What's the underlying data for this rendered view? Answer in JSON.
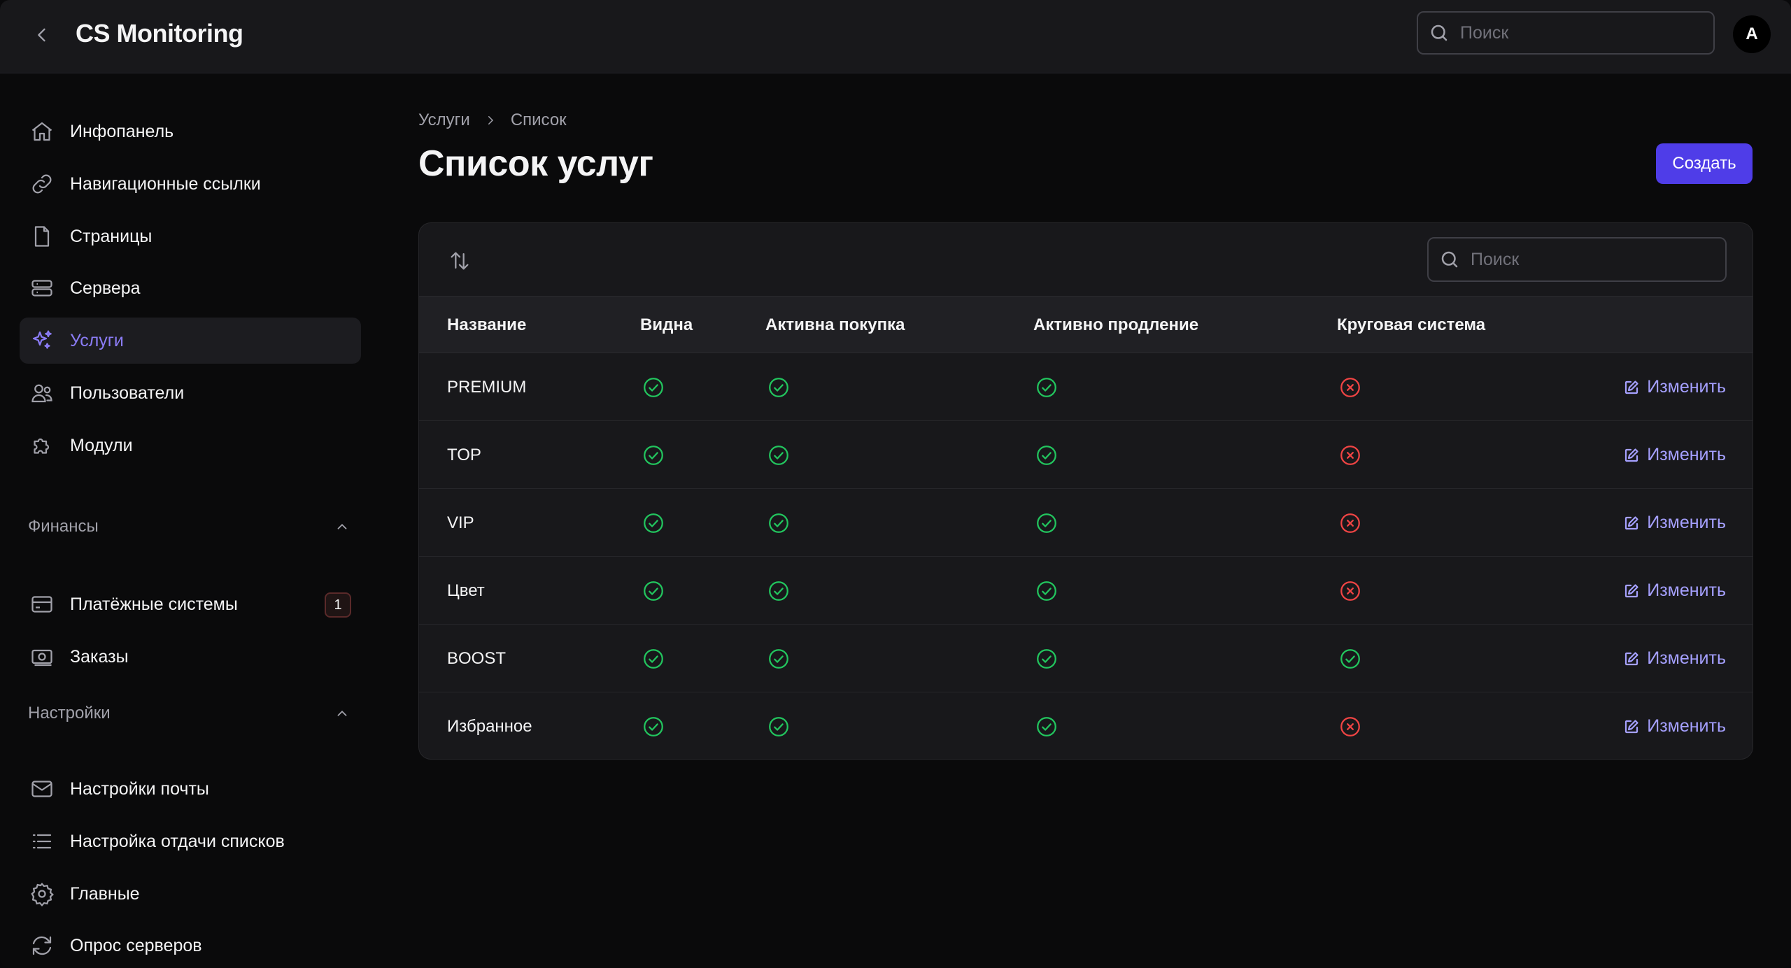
{
  "header": {
    "app_title": "CS Monitoring",
    "search_placeholder": "Поиск",
    "avatar_initial": "A"
  },
  "sidebar": {
    "items": [
      {
        "id": "dashboard",
        "label": "Инфопанель",
        "icon": "home-icon"
      },
      {
        "id": "nav-links",
        "label": "Навигационные ссылки",
        "icon": "link-icon"
      },
      {
        "id": "pages",
        "label": "Страницы",
        "icon": "document-icon"
      },
      {
        "id": "servers",
        "label": "Сервера",
        "icon": "server-icon"
      },
      {
        "id": "services",
        "label": "Услуги",
        "icon": "sparkles-icon",
        "active": true
      },
      {
        "id": "users",
        "label": "Пользователи",
        "icon": "users-icon"
      },
      {
        "id": "modules",
        "label": "Модули",
        "icon": "puzzle-icon"
      }
    ],
    "finance": {
      "title": "Финансы",
      "items": [
        {
          "id": "payment-systems",
          "label": "Платёжные системы",
          "icon": "credit-card-icon",
          "badge": "1"
        },
        {
          "id": "orders",
          "label": "Заказы",
          "icon": "cash-icon"
        }
      ]
    },
    "settings": {
      "title": "Настройки",
      "items": [
        {
          "id": "mail-settings",
          "label": "Настройки почты",
          "icon": "envelope-icon"
        },
        {
          "id": "list-output",
          "label": "Настройка отдачи списков",
          "icon": "list-icon"
        },
        {
          "id": "general",
          "label": "Главные",
          "icon": "gear-icon"
        },
        {
          "id": "server-polling",
          "label": "Опрос серверов",
          "icon": "refresh-icon"
        }
      ]
    }
  },
  "breadcrumb": {
    "parent": "Услуги",
    "current": "Список"
  },
  "page": {
    "title": "Список услуг",
    "create_label": "Создать"
  },
  "table": {
    "search_placeholder": "Поиск",
    "edit_label": "Изменить",
    "columns": [
      "Название",
      "Видна",
      "Активна покупка",
      "Активно продление",
      "Круговая система"
    ],
    "rows": [
      {
        "name": "PREMIUM",
        "visible": true,
        "purchase": true,
        "renewal": true,
        "round": false
      },
      {
        "name": "TOP",
        "visible": true,
        "purchase": true,
        "renewal": true,
        "round": false
      },
      {
        "name": "VIP",
        "visible": true,
        "purchase": true,
        "renewal": true,
        "round": false
      },
      {
        "name": "Цвет",
        "visible": true,
        "purchase": true,
        "renewal": true,
        "round": false
      },
      {
        "name": "BOOST",
        "visible": true,
        "purchase": true,
        "renewal": true,
        "round": true
      },
      {
        "name": "Избранное",
        "visible": true,
        "purchase": true,
        "renewal": true,
        "round": false
      }
    ]
  },
  "colors": {
    "accent": "#4f3de8",
    "active_nav": "#8b7cf6",
    "success": "#22c55e",
    "danger": "#ef4444",
    "link": "#a5a0ff"
  }
}
